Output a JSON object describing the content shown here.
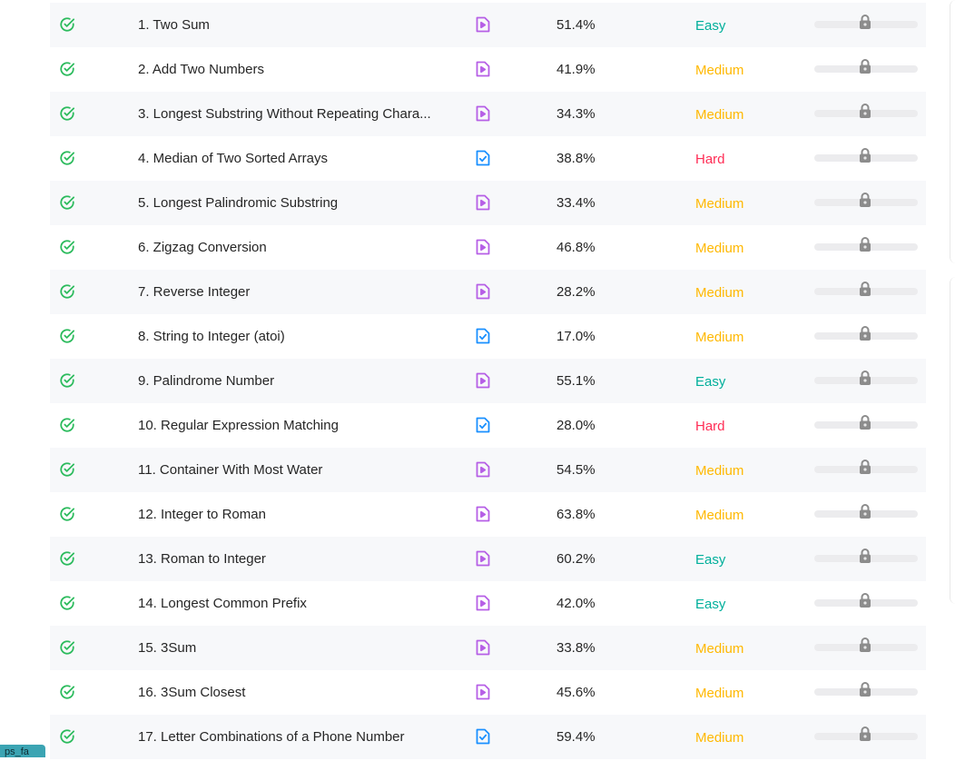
{
  "colors": {
    "easy": "#00af9b",
    "medium": "#ffb800",
    "hard": "#ff2d55",
    "solved": "#2cbb5d",
    "video_solution": "#b65fe6",
    "article_solution": "#1a90ff"
  },
  "problems": [
    {
      "title": "1. Two Sum",
      "acceptance": "51.4%",
      "difficulty": "Easy",
      "solution_icon": "video-solution-icon"
    },
    {
      "title": "2. Add Two Numbers",
      "acceptance": "41.9%",
      "difficulty": "Medium",
      "solution_icon": "video-solution-icon"
    },
    {
      "title": "3. Longest Substring Without Repeating Chara...",
      "acceptance": "34.3%",
      "difficulty": "Medium",
      "solution_icon": "video-solution-icon"
    },
    {
      "title": "4. Median of Two Sorted Arrays",
      "acceptance": "38.8%",
      "difficulty": "Hard",
      "solution_icon": "article-solution-icon"
    },
    {
      "title": "5. Longest Palindromic Substring",
      "acceptance": "33.4%",
      "difficulty": "Medium",
      "solution_icon": "video-solution-icon"
    },
    {
      "title": "6. Zigzag Conversion",
      "acceptance": "46.8%",
      "difficulty": "Medium",
      "solution_icon": "video-solution-icon"
    },
    {
      "title": "7. Reverse Integer",
      "acceptance": "28.2%",
      "difficulty": "Medium",
      "solution_icon": "video-solution-icon"
    },
    {
      "title": "8. String to Integer (atoi)",
      "acceptance": "17.0%",
      "difficulty": "Medium",
      "solution_icon": "article-solution-icon"
    },
    {
      "title": "9. Palindrome Number",
      "acceptance": "55.1%",
      "difficulty": "Easy",
      "solution_icon": "video-solution-icon"
    },
    {
      "title": "10. Regular Expression Matching",
      "acceptance": "28.0%",
      "difficulty": "Hard",
      "solution_icon": "article-solution-icon"
    },
    {
      "title": "11. Container With Most Water",
      "acceptance": "54.5%",
      "difficulty": "Medium",
      "solution_icon": "video-solution-icon"
    },
    {
      "title": "12. Integer to Roman",
      "acceptance": "63.8%",
      "difficulty": "Medium",
      "solution_icon": "video-solution-icon"
    },
    {
      "title": "13. Roman to Integer",
      "acceptance": "60.2%",
      "difficulty": "Easy",
      "solution_icon": "video-solution-icon"
    },
    {
      "title": "14. Longest Common Prefix",
      "acceptance": "42.0%",
      "difficulty": "Easy",
      "solution_icon": "video-solution-icon"
    },
    {
      "title": "15. 3Sum",
      "acceptance": "33.8%",
      "difficulty": "Medium",
      "solution_icon": "video-solution-icon"
    },
    {
      "title": "16. 3Sum Closest",
      "acceptance": "45.6%",
      "difficulty": "Medium",
      "solution_icon": "video-solution-icon"
    },
    {
      "title": "17. Letter Combinations of a Phone Number",
      "acceptance": "59.4%",
      "difficulty": "Medium",
      "solution_icon": "article-solution-icon"
    }
  ],
  "corner_tag": {
    "text": "ps_fa"
  }
}
